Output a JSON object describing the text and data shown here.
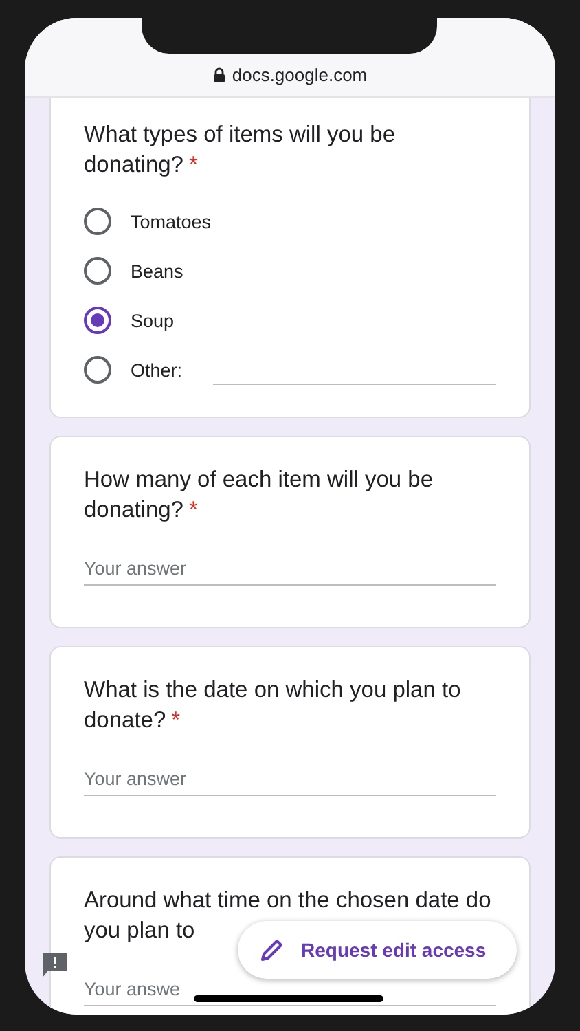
{
  "address_bar": {
    "url": "docs.google.com"
  },
  "questions": [
    {
      "kind": "choice",
      "title": "What types of items will you be donating?",
      "required_mark": "*",
      "options": [
        {
          "label": "Tomatoes",
          "selected": false,
          "kind": "plain"
        },
        {
          "label": "Beans",
          "selected": false,
          "kind": "plain"
        },
        {
          "label": "Soup",
          "selected": true,
          "kind": "plain"
        },
        {
          "label": "Other:",
          "selected": false,
          "kind": "other"
        }
      ]
    },
    {
      "kind": "text",
      "title": "How many of each item will you be donating?",
      "required_mark": "*",
      "placeholder": "Your answer"
    },
    {
      "kind": "text",
      "title": "What is the date on which you plan to donate?",
      "required_mark": "*",
      "placeholder": "Your answer"
    },
    {
      "kind": "text",
      "title": "Around what time on the chosen date do you plan to",
      "placeholder": "Your answe"
    }
  ],
  "fab": {
    "label": "Request edit access"
  }
}
